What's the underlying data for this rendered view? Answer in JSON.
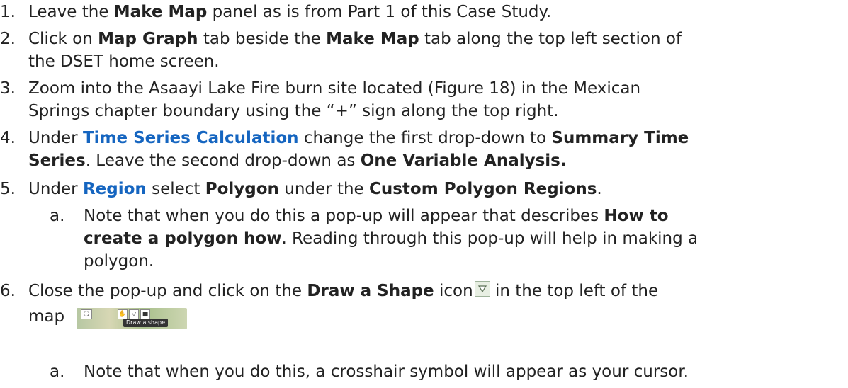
{
  "items": [
    {
      "num": "1.",
      "lines": [
        [
          "Leave the ",
          {
            "b": "Make Map"
          },
          " panel as is from Part 1 of this Case Study."
        ]
      ]
    },
    {
      "num": "2.",
      "lines": [
        [
          "Click on ",
          {
            "b": "Map Graph"
          },
          " tab beside the ",
          {
            "b": "Make Map"
          },
          " tab along the top left section of"
        ],
        [
          "the DSET home screen."
        ]
      ]
    },
    {
      "num": "3.",
      "lines": [
        [
          "Zoom into the Asaayi Lake Fire burn site located (Figure 18) in the Mexican"
        ],
        [
          "Springs chapter boundary using the “+” sign along the top right."
        ]
      ]
    },
    {
      "num": "4.",
      "lines": [
        [
          "Under ",
          {
            "blue": "Time Series Calculation"
          },
          " change the first drop-down to ",
          {
            "b": "Summary Time"
          }
        ],
        [
          {
            "b": "Series"
          },
          ". Leave the second drop-down as ",
          {
            "b": "One Variable Analysis."
          }
        ]
      ]
    },
    {
      "num": "5.",
      "lines": [
        [
          "Under ",
          {
            "blue": "Region"
          },
          " select ",
          {
            "b": "Polygon"
          },
          " under the ",
          {
            "b": "Custom Polygon Regions"
          },
          "."
        ]
      ]
    },
    {
      "num": "a.",
      "sub": true,
      "lines": [
        [
          "Note that when you do this a pop-up will appear that describes ",
          {
            "b": "How to"
          }
        ],
        [
          {
            "b": "create a polygon how"
          },
          ". Reading through this pop-up will help in making a"
        ],
        [
          "polygon."
        ]
      ]
    },
    {
      "num": "6.",
      "lines": [
        [
          "Close the pop-up and click on the ",
          {
            "b": "Draw a Shape"
          },
          " icon",
          {
            "icon": "draw-shape-icon"
          },
          " in the top left of the"
        ],
        [
          "map",
          {
            "thumb": "map-toolbar-thumbnail"
          }
        ]
      ]
    },
    {
      "num": "a.",
      "sub": true,
      "lines": [
        [
          "Note that when you do this, a crosshair symbol will appear as your cursor."
        ]
      ]
    }
  ],
  "map_thumbnail": {
    "tooltip": "Draw a shape"
  }
}
